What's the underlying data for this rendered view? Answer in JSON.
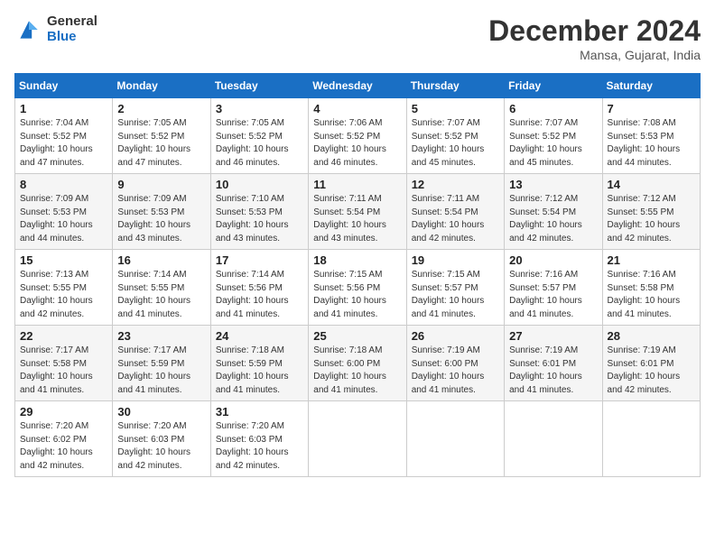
{
  "header": {
    "logo_general": "General",
    "logo_blue": "Blue",
    "month_title": "December 2024",
    "location": "Mansa, Gujarat, India"
  },
  "days_of_week": [
    "Sunday",
    "Monday",
    "Tuesday",
    "Wednesday",
    "Thursday",
    "Friday",
    "Saturday"
  ],
  "weeks": [
    [
      {
        "day": "1",
        "info": "Sunrise: 7:04 AM\nSunset: 5:52 PM\nDaylight: 10 hours\nand 47 minutes."
      },
      {
        "day": "2",
        "info": "Sunrise: 7:05 AM\nSunset: 5:52 PM\nDaylight: 10 hours\nand 47 minutes."
      },
      {
        "day": "3",
        "info": "Sunrise: 7:05 AM\nSunset: 5:52 PM\nDaylight: 10 hours\nand 46 minutes."
      },
      {
        "day": "4",
        "info": "Sunrise: 7:06 AM\nSunset: 5:52 PM\nDaylight: 10 hours\nand 46 minutes."
      },
      {
        "day": "5",
        "info": "Sunrise: 7:07 AM\nSunset: 5:52 PM\nDaylight: 10 hours\nand 45 minutes."
      },
      {
        "day": "6",
        "info": "Sunrise: 7:07 AM\nSunset: 5:52 PM\nDaylight: 10 hours\nand 45 minutes."
      },
      {
        "day": "7",
        "info": "Sunrise: 7:08 AM\nSunset: 5:53 PM\nDaylight: 10 hours\nand 44 minutes."
      }
    ],
    [
      {
        "day": "8",
        "info": "Sunrise: 7:09 AM\nSunset: 5:53 PM\nDaylight: 10 hours\nand 44 minutes."
      },
      {
        "day": "9",
        "info": "Sunrise: 7:09 AM\nSunset: 5:53 PM\nDaylight: 10 hours\nand 43 minutes."
      },
      {
        "day": "10",
        "info": "Sunrise: 7:10 AM\nSunset: 5:53 PM\nDaylight: 10 hours\nand 43 minutes."
      },
      {
        "day": "11",
        "info": "Sunrise: 7:11 AM\nSunset: 5:54 PM\nDaylight: 10 hours\nand 43 minutes."
      },
      {
        "day": "12",
        "info": "Sunrise: 7:11 AM\nSunset: 5:54 PM\nDaylight: 10 hours\nand 42 minutes."
      },
      {
        "day": "13",
        "info": "Sunrise: 7:12 AM\nSunset: 5:54 PM\nDaylight: 10 hours\nand 42 minutes."
      },
      {
        "day": "14",
        "info": "Sunrise: 7:12 AM\nSunset: 5:55 PM\nDaylight: 10 hours\nand 42 minutes."
      }
    ],
    [
      {
        "day": "15",
        "info": "Sunrise: 7:13 AM\nSunset: 5:55 PM\nDaylight: 10 hours\nand 42 minutes."
      },
      {
        "day": "16",
        "info": "Sunrise: 7:14 AM\nSunset: 5:55 PM\nDaylight: 10 hours\nand 41 minutes."
      },
      {
        "day": "17",
        "info": "Sunrise: 7:14 AM\nSunset: 5:56 PM\nDaylight: 10 hours\nand 41 minutes."
      },
      {
        "day": "18",
        "info": "Sunrise: 7:15 AM\nSunset: 5:56 PM\nDaylight: 10 hours\nand 41 minutes."
      },
      {
        "day": "19",
        "info": "Sunrise: 7:15 AM\nSunset: 5:57 PM\nDaylight: 10 hours\nand 41 minutes."
      },
      {
        "day": "20",
        "info": "Sunrise: 7:16 AM\nSunset: 5:57 PM\nDaylight: 10 hours\nand 41 minutes."
      },
      {
        "day": "21",
        "info": "Sunrise: 7:16 AM\nSunset: 5:58 PM\nDaylight: 10 hours\nand 41 minutes."
      }
    ],
    [
      {
        "day": "22",
        "info": "Sunrise: 7:17 AM\nSunset: 5:58 PM\nDaylight: 10 hours\nand 41 minutes."
      },
      {
        "day": "23",
        "info": "Sunrise: 7:17 AM\nSunset: 5:59 PM\nDaylight: 10 hours\nand 41 minutes."
      },
      {
        "day": "24",
        "info": "Sunrise: 7:18 AM\nSunset: 5:59 PM\nDaylight: 10 hours\nand 41 minutes."
      },
      {
        "day": "25",
        "info": "Sunrise: 7:18 AM\nSunset: 6:00 PM\nDaylight: 10 hours\nand 41 minutes."
      },
      {
        "day": "26",
        "info": "Sunrise: 7:19 AM\nSunset: 6:00 PM\nDaylight: 10 hours\nand 41 minutes."
      },
      {
        "day": "27",
        "info": "Sunrise: 7:19 AM\nSunset: 6:01 PM\nDaylight: 10 hours\nand 41 minutes."
      },
      {
        "day": "28",
        "info": "Sunrise: 7:19 AM\nSunset: 6:01 PM\nDaylight: 10 hours\nand 42 minutes."
      }
    ],
    [
      {
        "day": "29",
        "info": "Sunrise: 7:20 AM\nSunset: 6:02 PM\nDaylight: 10 hours\nand 42 minutes."
      },
      {
        "day": "30",
        "info": "Sunrise: 7:20 AM\nSunset: 6:03 PM\nDaylight: 10 hours\nand 42 minutes."
      },
      {
        "day": "31",
        "info": "Sunrise: 7:20 AM\nSunset: 6:03 PM\nDaylight: 10 hours\nand 42 minutes."
      },
      null,
      null,
      null,
      null
    ]
  ]
}
